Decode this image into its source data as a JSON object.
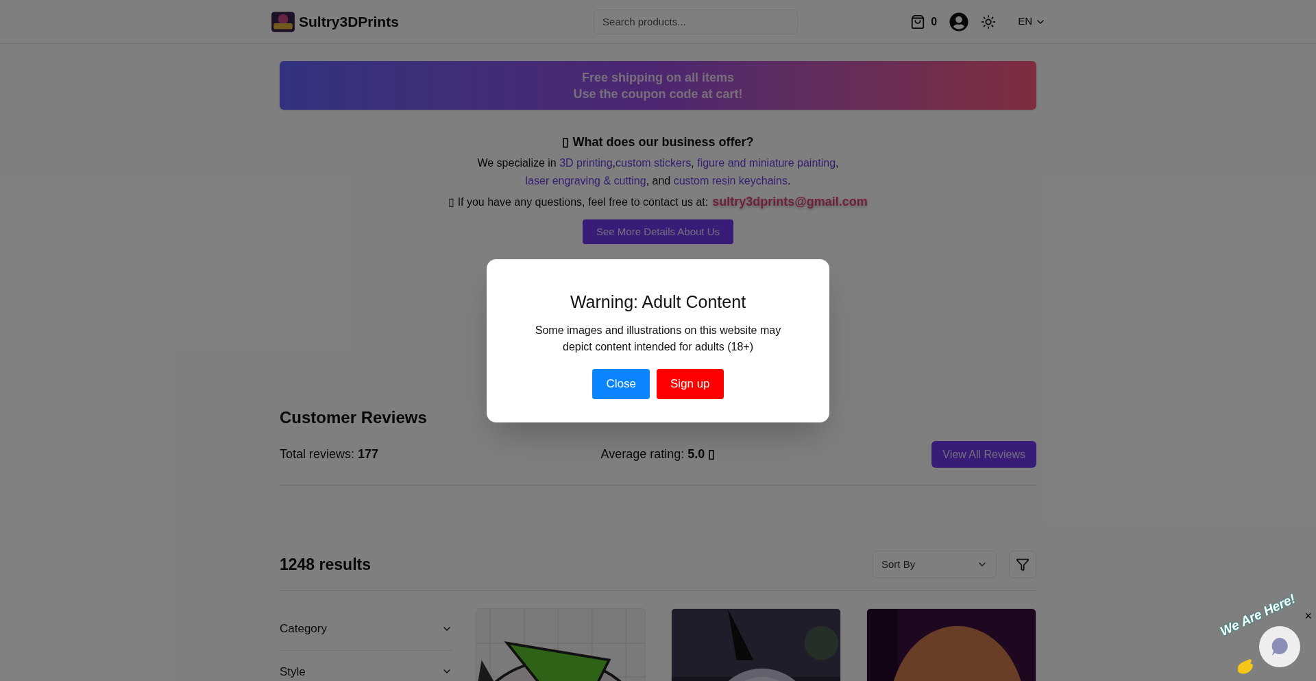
{
  "header": {
    "brand": "Sultry3DPrints",
    "search": {
      "placeholder": "Search products..."
    },
    "cart_count": "0",
    "language": "EN"
  },
  "banner": {
    "lines": [
      "Free shipping on all items",
      "Use the coupon code at cart!"
    ]
  },
  "about": {
    "heading": "▯ What does our business offer?",
    "paragraph": [
      [
        {
          "kind": "text",
          "text": "We specialize in "
        },
        {
          "kind": "link",
          "text": "3D printing"
        },
        {
          "kind": "text",
          "text": ","
        },
        {
          "kind": "link",
          "text": "custom stickers"
        },
        {
          "kind": "text",
          "text": ", "
        },
        {
          "kind": "link",
          "text": "figure and miniature painting"
        },
        {
          "kind": "text",
          "text": ","
        }
      ],
      [
        {
          "kind": "link",
          "text": "laser engraving & cutting"
        },
        {
          "kind": "text",
          "text": ", and "
        },
        {
          "kind": "link",
          "text": "custom resin keychains"
        },
        {
          "kind": "text",
          "text": "."
        }
      ]
    ],
    "contact": {
      "text": "▯ If you have any questions, feel free to contact us at:",
      "email": "sultry3dprints@gmail.com"
    },
    "button": "See More Details About Us"
  },
  "reviews": {
    "title": "Customer Reviews",
    "total_label": "Total reviews:",
    "total": "177",
    "average_label": "Average rating:",
    "average": "5.0 ▯",
    "button": "View All Reviews"
  },
  "results": {
    "count": "1248 results",
    "sort": {
      "placeholder": "Sort By"
    }
  },
  "filters": [
    {
      "label": "Category"
    },
    {
      "label": "Style"
    }
  ],
  "modal": {
    "title": "Warning: Adult Content",
    "text": "Some images and illustrations on this website may depict content intended for adults (18+)",
    "buttons": [
      {
        "label": "Close",
        "kind": "secondary"
      },
      {
        "label": "Sign up",
        "kind": "primary"
      }
    ]
  },
  "chat": {
    "label": "We Are Here!",
    "close": "×"
  }
}
